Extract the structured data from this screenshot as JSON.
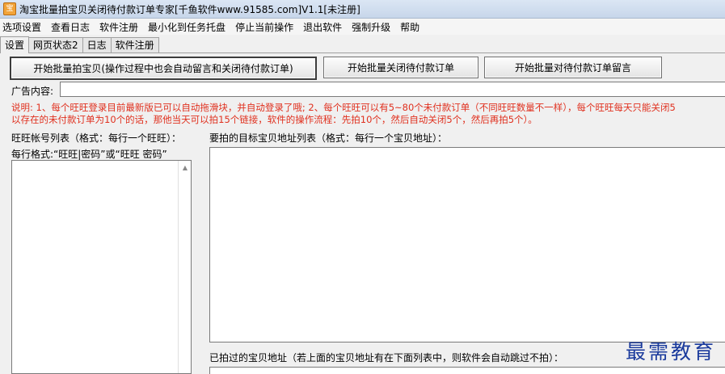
{
  "window": {
    "title": "淘宝批量拍宝贝关闭待付款订单专家[千鱼软件www.91585.com]V1.1[未注册]",
    "icon": "app-icon"
  },
  "menu": [
    "选项设置",
    "查看日志",
    "软件注册",
    "最小化到任务托盘",
    "停止当前操作",
    "退出软件",
    "强制升级",
    "帮助"
  ],
  "tabs": [
    "设置",
    "网页状态2",
    "日志",
    "软件注册"
  ],
  "buttons": {
    "start_buy": "开始批量拍宝贝(操作过程中也会自动留言和关闭待付款订单)",
    "close_unpaid": "开始批量关闭待付款订单",
    "leave_message": "开始批量对待付款订单留言"
  },
  "ad": {
    "label": "广告内容:",
    "value": ""
  },
  "note": {
    "line1": "说明: 1、每个旺旺登录目前最新版已可以自动拖滑块，并自动登录了哦; 2、每个旺旺可以有5~80个未付款订单（不同旺旺数量不一样），每个旺旺每天只能关闭5",
    "line2": "以存在的未付款订单为10个的话，那他当天可以拍15个链接，软件的操作流程：先拍10个，然后自动关闭5个，然后再拍5个）。"
  },
  "accounts": {
    "label": "旺旺帐号列表（格式：每行一个旺旺）：",
    "format": "每行格式:“旺旺|密码”或“旺旺 密码”"
  },
  "targets": {
    "label": "要拍的目标宝贝地址列表（格式：每行一个宝贝地址）："
  },
  "done": {
    "label": "已拍过的宝贝地址（若上面的宝贝地址有在下面列表中，则软件会自动跳过不拍）："
  },
  "watermark": "最需教育"
}
